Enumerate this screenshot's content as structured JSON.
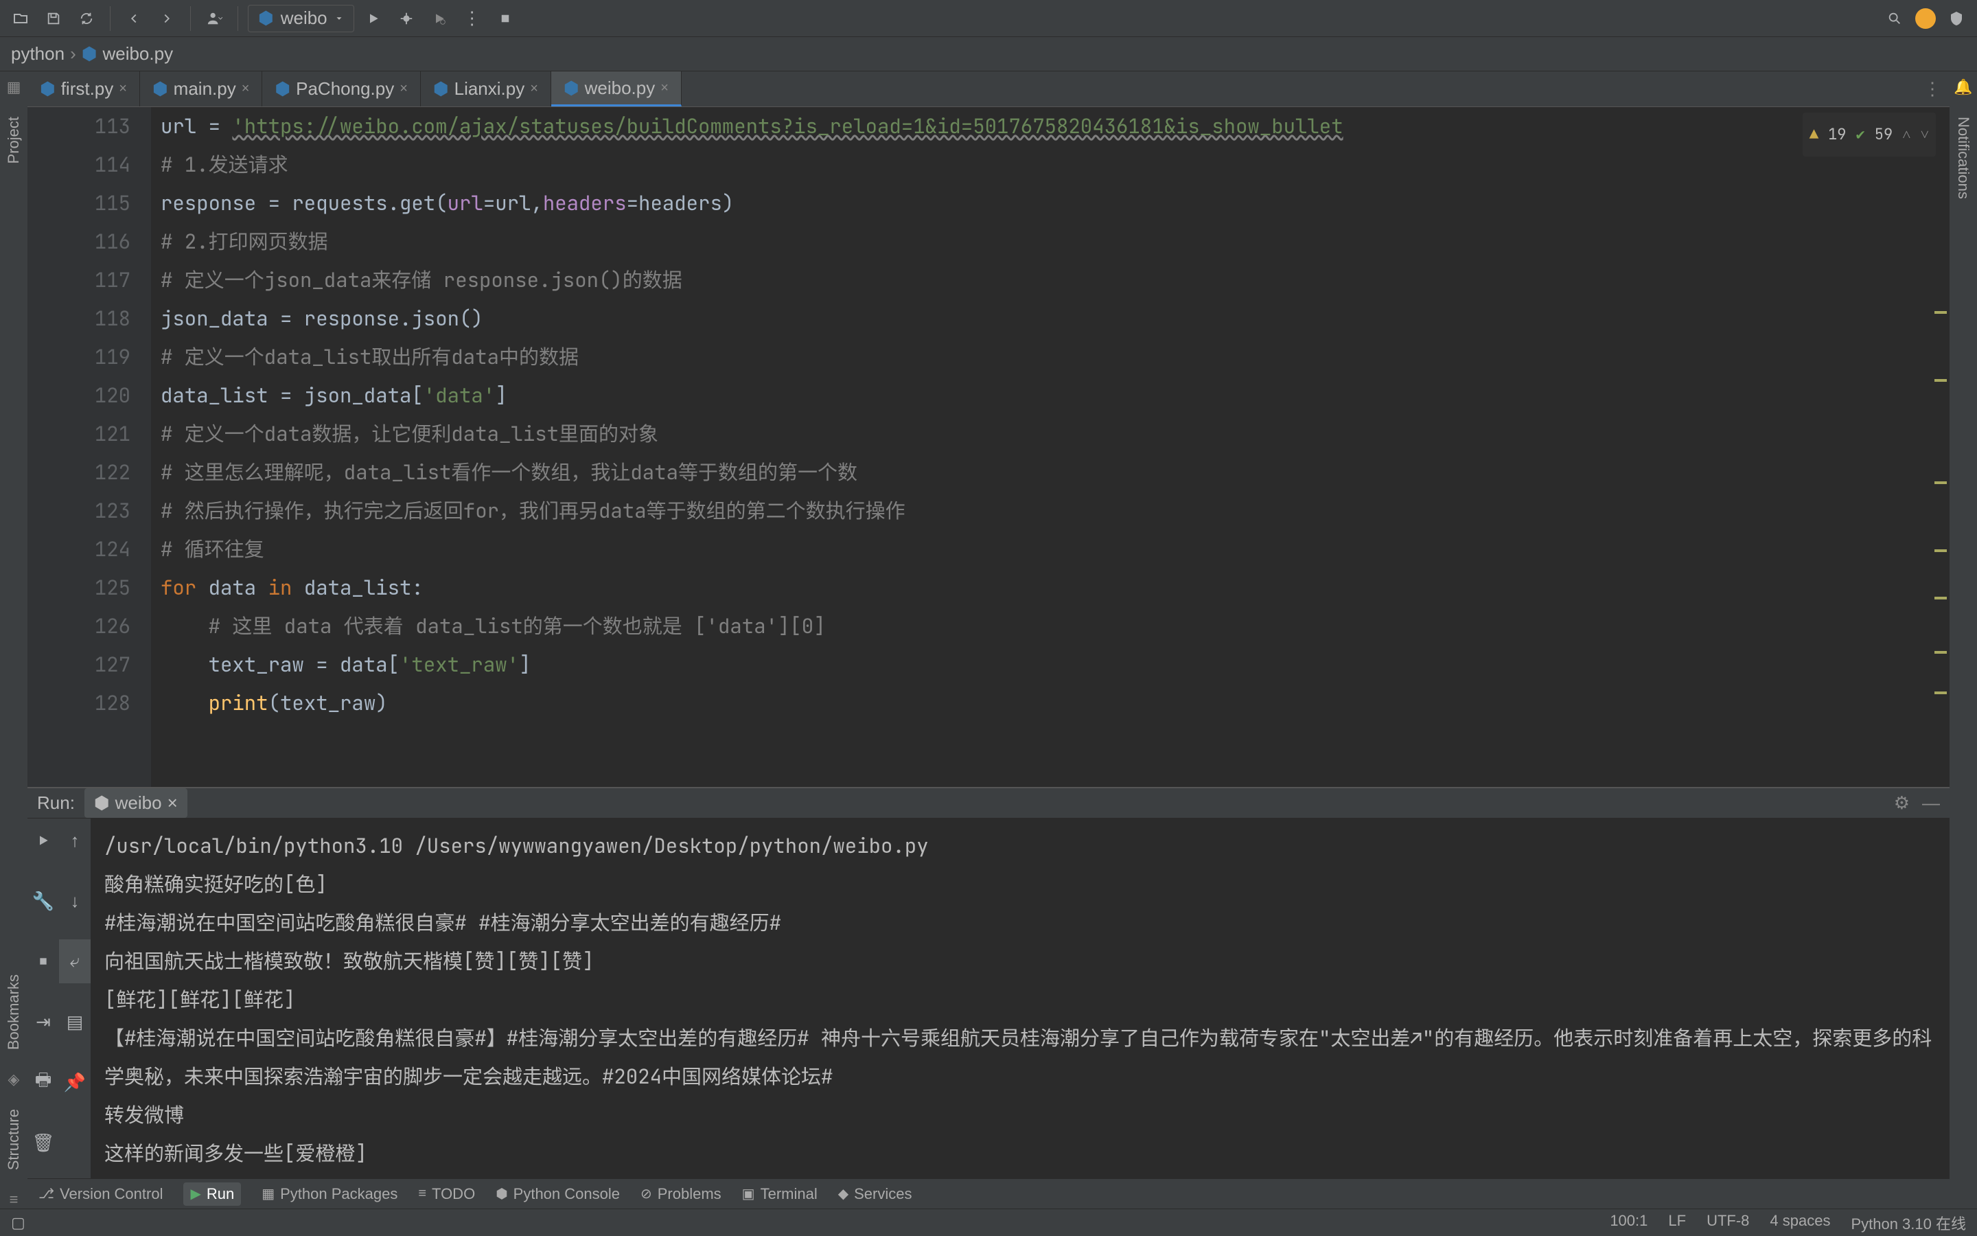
{
  "toolbar": {
    "run_config": "weibo"
  },
  "breadcrumb": {
    "project": "python",
    "file": "weibo.py"
  },
  "tabs": [
    {
      "label": "first.py",
      "active": false
    },
    {
      "label": "main.py",
      "active": false
    },
    {
      "label": "PaChong.py",
      "active": false
    },
    {
      "label": "Lianxi.py",
      "active": false
    },
    {
      "label": "weibo.py",
      "active": true
    }
  ],
  "inspection": {
    "warn_count": "19",
    "ok_count": "59"
  },
  "gutter_start": 113,
  "gutter_end": 128,
  "code_lines": [
    {
      "tokens": [
        {
          "t": "url = ",
          "c": ""
        },
        {
          "t": "'https://weibo.com/ajax/statuses/buildComments?is_reload=1&id=5017675820436181&is_show_bullet",
          "c": "c-str underline-warn"
        }
      ]
    },
    {
      "tokens": [
        {
          "t": "# 1.发送请求",
          "c": "c-cmt"
        }
      ]
    },
    {
      "tokens": [
        {
          "t": "response = requests.get(",
          "c": ""
        },
        {
          "t": "url",
          "c": "c-param"
        },
        {
          "t": "=url,",
          "c": ""
        },
        {
          "t": "headers",
          "c": "c-param"
        },
        {
          "t": "=headers)",
          "c": ""
        }
      ]
    },
    {
      "tokens": [
        {
          "t": "# 2.打印网页数据",
          "c": "c-cmt"
        }
      ]
    },
    {
      "tokens": [
        {
          "t": "# 定义一个json_data来存储 response.json()的数据",
          "c": "c-cmt"
        }
      ]
    },
    {
      "tokens": [
        {
          "t": "json_data = response.json()",
          "c": ""
        }
      ]
    },
    {
      "tokens": [
        {
          "t": "# 定义一个data_list取出所有data中的数据",
          "c": "c-cmt"
        }
      ]
    },
    {
      "tokens": [
        {
          "t": "data_list = json_data[",
          "c": ""
        },
        {
          "t": "'data'",
          "c": "c-str"
        },
        {
          "t": "]",
          "c": ""
        }
      ]
    },
    {
      "tokens": [
        {
          "t": "# 定义一个data数据，让它便利data_list里面的对象",
          "c": "c-cmt"
        }
      ]
    },
    {
      "tokens": [
        {
          "t": "# 这里怎么理解呢，data_list看作一个数组，我让data等于数组的第一个数",
          "c": "c-cmt"
        }
      ]
    },
    {
      "tokens": [
        {
          "t": "# 然后执行操作，执行完之后返回for，我们再另data等于数组的第二个数执行操作",
          "c": "c-cmt"
        }
      ]
    },
    {
      "tokens": [
        {
          "t": "# 循环往复",
          "c": "c-cmt"
        }
      ]
    },
    {
      "tokens": [
        {
          "t": "for",
          "c": "c-kw"
        },
        {
          "t": " data ",
          "c": ""
        },
        {
          "t": "in",
          "c": "c-kw"
        },
        {
          "t": " data_list:",
          "c": ""
        }
      ]
    },
    {
      "tokens": [
        {
          "t": "    ",
          "c": ""
        },
        {
          "t": "# 这里 data 代表着 data_list的第一个数也就是 ['data'][0]",
          "c": "c-cmt"
        }
      ]
    },
    {
      "tokens": [
        {
          "t": "    text_raw = data[",
          "c": ""
        },
        {
          "t": "'text_raw'",
          "c": "c-str"
        },
        {
          "t": "]",
          "c": ""
        }
      ]
    },
    {
      "tokens": [
        {
          "t": "    ",
          "c": ""
        },
        {
          "t": "print",
          "c": "c-fn"
        },
        {
          "t": "(text_raw)",
          "c": ""
        }
      ]
    }
  ],
  "run": {
    "label": "Run:",
    "tab_name": "weibo",
    "output": [
      "/usr/local/bin/python3.10 /Users/wywwangyawen/Desktop/python/weibo.py",
      "酸角糕确实挺好吃的[色]",
      "#桂海潮说在中国空间站吃酸角糕很自豪# #桂海潮分享太空出差的有趣经历#",
      "向祖国航天战士楷模致敬！致敬航天楷模[赞][赞][赞]",
      "[鲜花][鲜花][鲜花]",
      "【#桂海潮说在中国空间站吃酸角糕很自豪#】#桂海潮分享太空出差的有趣经历# 神舟十六号乘组航天员桂海潮分享了自己作为载荷专家在\"太空出差↗\"的有趣经历。他表示时刻准备着再上太空，探索更多的科学奥秘，未来中国探索浩瀚宇宙的脚步一定会越走越远。#2024中国网络媒体论坛#",
      "转发微博",
      "这样的新闻多发一些[爱橙橙]"
    ]
  },
  "bottom_tools": {
    "version_control": "Version Control",
    "run": "Run",
    "python_packages": "Python Packages",
    "todo": "TODO",
    "python_console": "Python Console",
    "problems": "Problems",
    "terminal": "Terminal",
    "services": "Services"
  },
  "status": {
    "position": "100:1",
    "line_sep": "LF",
    "encoding": "UTF-8",
    "indent": "4 spaces",
    "interpreter": "Python 3.10 在线"
  },
  "side_right": {
    "notifications": "Notifications"
  },
  "side_left": {
    "project": "Project",
    "bookmarks": "Bookmarks",
    "structure": "Structure"
  }
}
